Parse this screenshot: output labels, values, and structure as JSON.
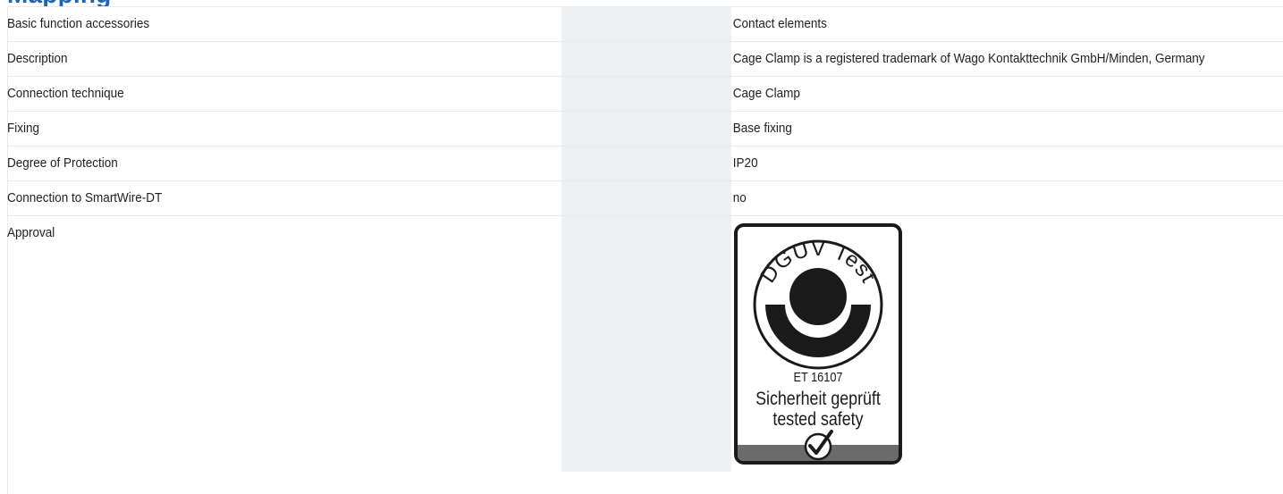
{
  "section_heading": "Mapping",
  "rows": [
    {
      "label": "Basic function accessories",
      "value": "Contact elements"
    },
    {
      "label": "Description",
      "value": "Cage Clamp is a registered trademark of Wago Kontakttechnik GmbH/Minden, Germany"
    },
    {
      "label": "Connection technique",
      "value": "Cage Clamp"
    },
    {
      "label": "Fixing",
      "value": "Base fixing"
    },
    {
      "label": "Degree of Protection",
      "value": "IP20"
    },
    {
      "label": "Connection to SmartWire-DT",
      "value": "no"
    }
  ],
  "approval": {
    "label": "Approval",
    "badge": {
      "name": "dguv-test-badge",
      "ring_text": "DGUV Test",
      "cert_number": "ET 16107",
      "line_de": "Sicherheit geprüft",
      "line_en": "tested safety",
      "check_icon": "check-circle-icon"
    }
  }
}
